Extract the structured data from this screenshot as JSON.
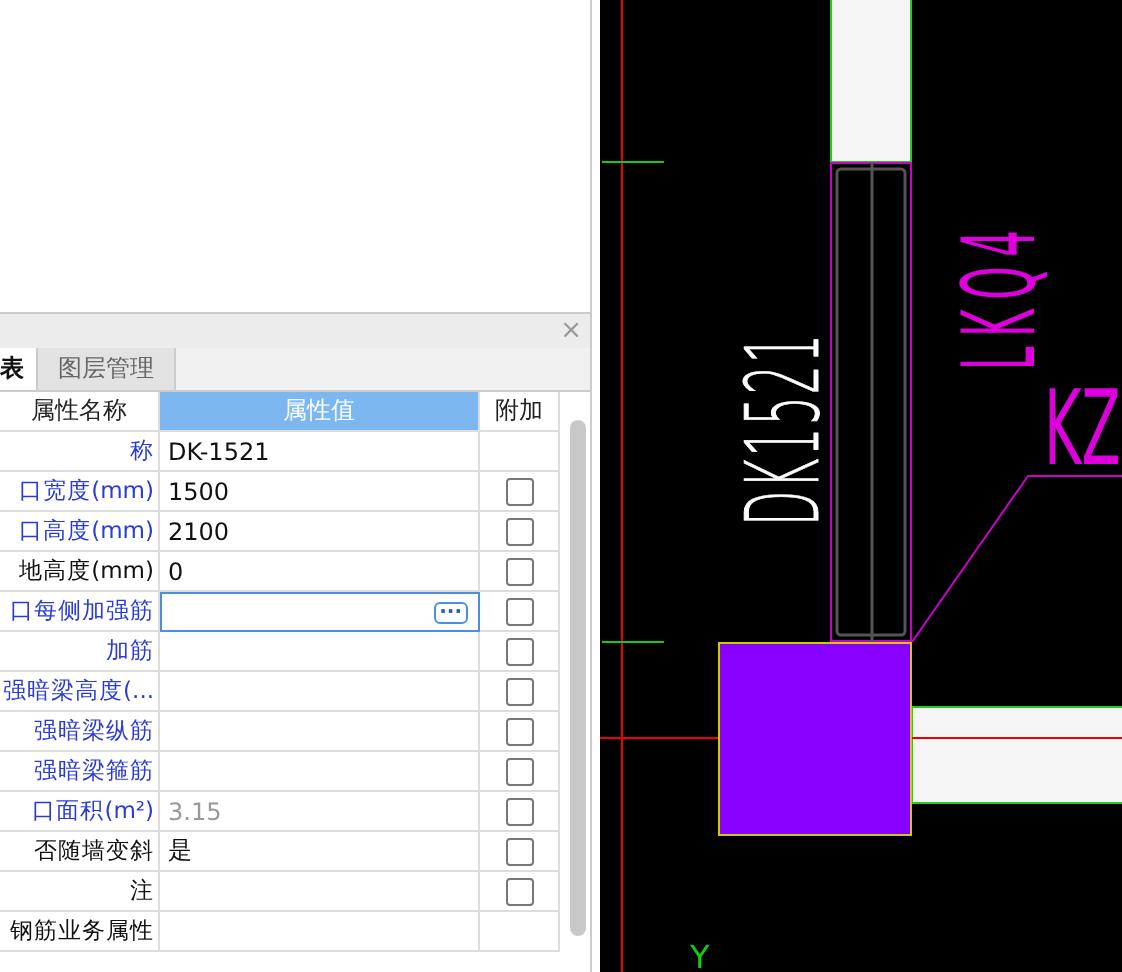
{
  "panel": {
    "close": "×",
    "tabs": [
      {
        "label": "表",
        "selected": true
      },
      {
        "label": "图层管理",
        "selected": false
      }
    ]
  },
  "table": {
    "columns": [
      "属性名称",
      "属性值",
      "附加"
    ],
    "rows": [
      {
        "name": "称",
        "public": true,
        "kind": "text",
        "value": "DK-1521"
      },
      {
        "name": "口宽度(mm)",
        "public": true,
        "kind": "text",
        "value": "1500",
        "checked": false
      },
      {
        "name": "口高度(mm)",
        "public": true,
        "kind": "text",
        "value": "2100",
        "checked": false
      },
      {
        "name": "地高度(mm)",
        "public": false,
        "kind": "text",
        "value": "0",
        "checked": false
      },
      {
        "name": "口每侧加强筋",
        "public": true,
        "kind": "editing",
        "edit_button": "···",
        "checked": false
      },
      {
        "name": "加筋",
        "public": true,
        "kind": "text",
        "checked": false
      },
      {
        "name": "强暗梁高度(...",
        "public": true,
        "kind": "text",
        "checked": false
      },
      {
        "name": "强暗梁纵筋",
        "public": true,
        "kind": "text",
        "checked": false
      },
      {
        "name": "强暗梁箍筋",
        "public": true,
        "kind": "text",
        "checked": false
      },
      {
        "name": "口面积(m²)",
        "public": true,
        "kind": "readonly",
        "value": "3.15",
        "checked": false
      },
      {
        "name": "否随墙变斜",
        "public": false,
        "kind": "text",
        "value": "是",
        "checked": false
      },
      {
        "name": "注",
        "public": false,
        "kind": "text",
        "checked": false
      },
      {
        "name": "钢筋业务属性",
        "public": false,
        "kind": "text"
      }
    ]
  },
  "canvas": {
    "labels": [
      {
        "text": "DK1521",
        "kind": "opening"
      },
      {
        "text": "LKQ4",
        "kind": "beam"
      },
      {
        "text": "KZ",
        "kind": "column"
      },
      {
        "text": "Y",
        "kind": "axis"
      }
    ]
  }
}
